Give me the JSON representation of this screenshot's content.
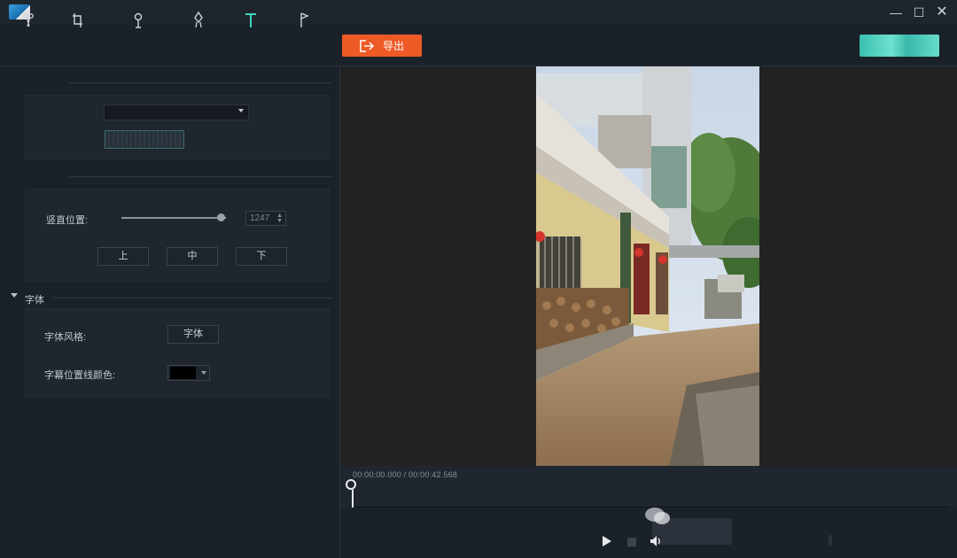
{
  "toolbar": {
    "export_label": "导出",
    "tools": [
      "scissors-icon",
      "crop-icon",
      "pin-icon",
      "marker-icon",
      "text-icon",
      "flag-icon"
    ]
  },
  "subtitle_position": {
    "vertical_label": "竖直位置:",
    "vertical_value": "1247",
    "slider_fraction": 0.95,
    "up_label": "上",
    "middle_label": "中",
    "down_label": "下"
  },
  "font_section": {
    "title": "字体",
    "style_label": "字体风格:",
    "style_button": "字体",
    "line_color_label": "字幕位置线颜色:",
    "line_color": "#000000"
  },
  "timeline": {
    "timecode": "00:00:00.000 / 00:00:42.568"
  },
  "colors": {
    "accent": "#ee5a26",
    "account_button": "#4fcfbf",
    "panel_bg": "#1b2129"
  }
}
